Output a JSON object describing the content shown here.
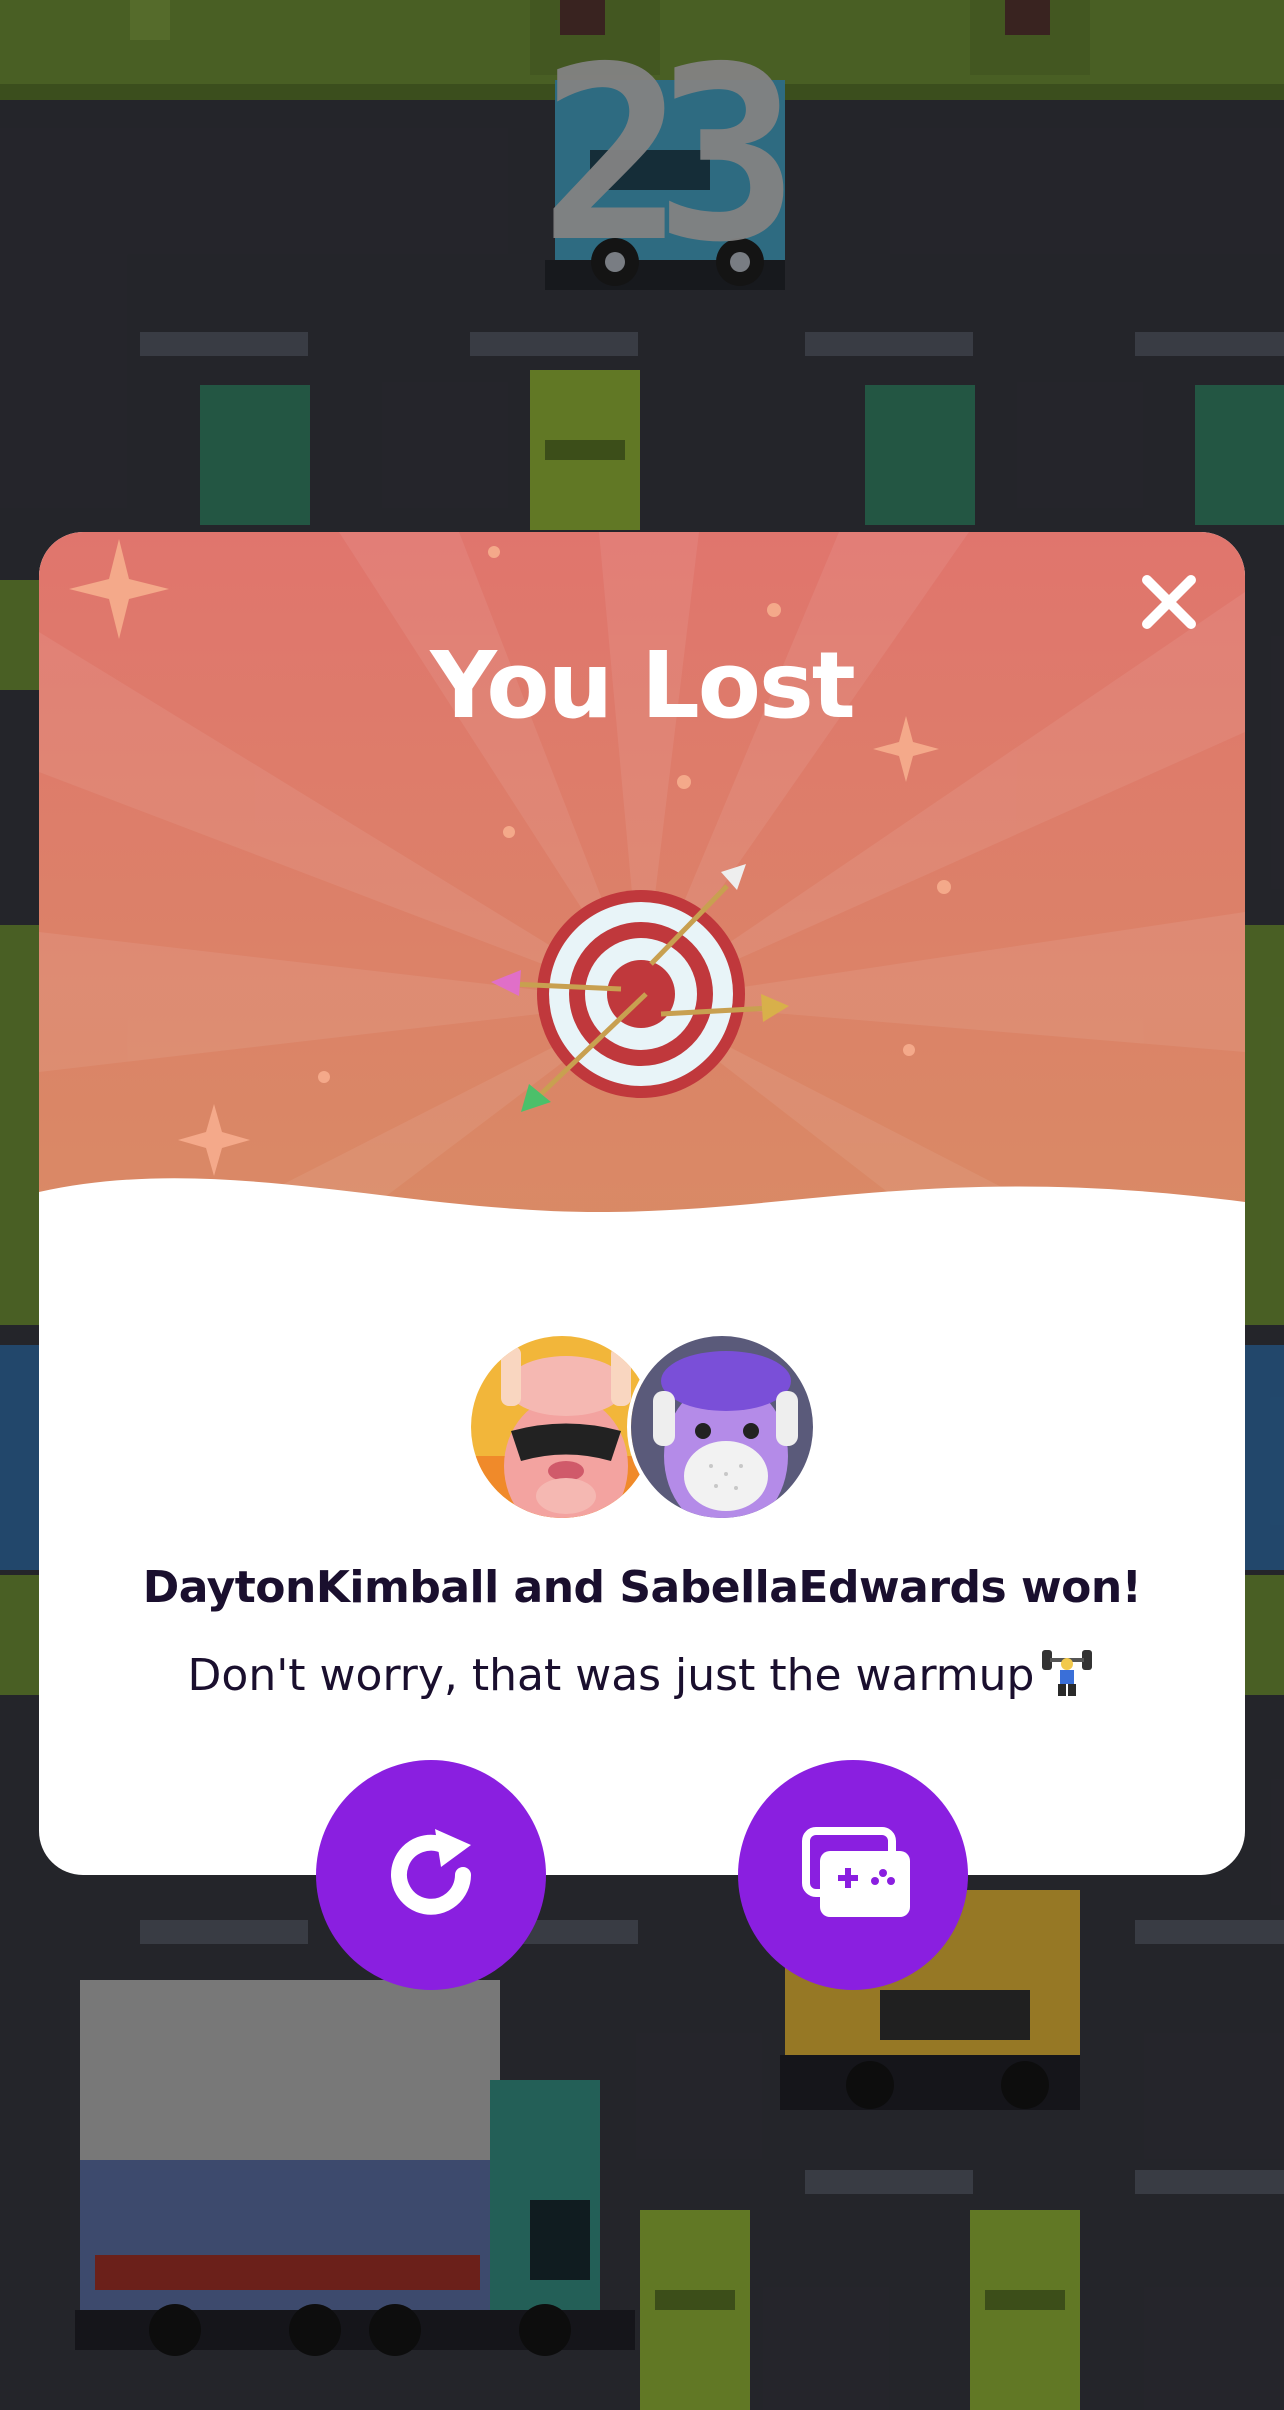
{
  "game": {
    "score": "23"
  },
  "modal": {
    "title": "You Lost",
    "winners_text": "DaytonKimball and SabellaEdwards won!",
    "subtitle_text": "Don't worry, that was just the warmup",
    "players": [
      {
        "avatar": "llama-sunglasses-avatar"
      },
      {
        "avatar": "llama-mask-headphones-avatar"
      }
    ],
    "close_icon": "close-icon",
    "emoji": "weightlifter-trophy-emoji"
  },
  "actions": {
    "replay_icon": "replay-icon",
    "more_games_icon": "game-library-icon"
  },
  "colors": {
    "accent_purple": "#8a1fe0",
    "header_top": "#e0756d",
    "header_bottom": "#d98a65",
    "text_dark": "#1a0f2e"
  }
}
